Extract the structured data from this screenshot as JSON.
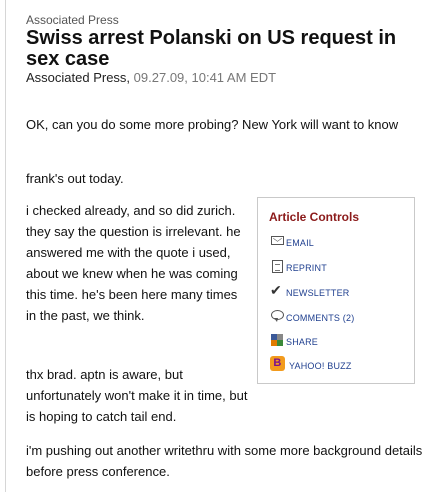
{
  "article": {
    "source": "Associated Press",
    "headline": "Swiss arrest Polanski on US request in sex case",
    "byline_author": "Associated Press,",
    "byline_date": "09.27.09, 10:41 AM EDT"
  },
  "body": {
    "p1": "OK, can you do some more probing? New York will want to know",
    "p2": "frank's out today.",
    "p3": "i checked already, and so did zurich. they say the question is irrelevant. he answered me with the quote i used, about we knew when he was coming this time. he's been here many times in the past, we think.",
    "p4": "thx brad. aptn is aware, but unfortunately won't make it in time, but is hoping to catch tail end.",
    "p5": "i'm pushing out another writethru with some more background details before press conference."
  },
  "controls": {
    "title": "Article Controls",
    "email": "EMAIL",
    "reprint": "REPRINT",
    "newsletter": "NEWSLETTER",
    "comments": "COMMENTS (2)",
    "share": "SHARE",
    "buzz": "YAHOO! BUZZ",
    "buzz_glyph": "b"
  },
  "colors": {
    "controls_title": "#8b1a1a",
    "control_link": "#1f3f8f",
    "buzz_icon_bg": "#f29b1d"
  }
}
